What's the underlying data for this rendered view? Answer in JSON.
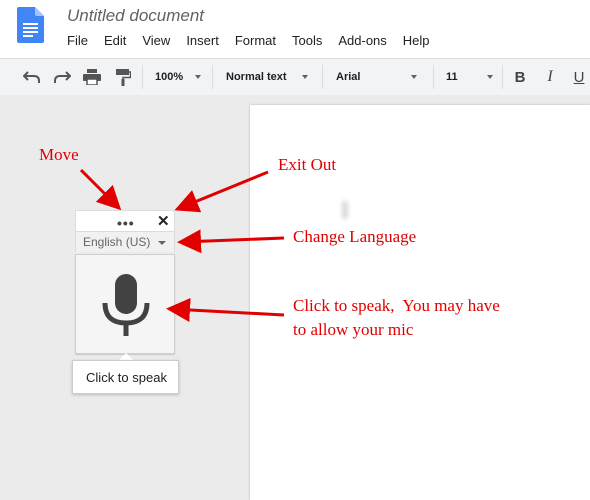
{
  "document": {
    "title": "Untitled document"
  },
  "menu": [
    "File",
    "Edit",
    "View",
    "Insert",
    "Format",
    "Tools",
    "Add-ons",
    "Help"
  ],
  "toolbar": {
    "zoom": "100%",
    "style": "Normal text",
    "font": "Arial",
    "size": "11",
    "bold": "B",
    "italic": "I",
    "underline": "U"
  },
  "voice_typing": {
    "language": "English (US)",
    "tooltip": "Click to speak"
  },
  "annotations": {
    "move": "Move",
    "exit": "Exit Out",
    "language": "Change Language",
    "speak_line1": "Click to speak,  You may have",
    "speak_line2": "to allow your mic"
  },
  "colors": {
    "annotation": "#e00000",
    "docs_blue": "#4285f4"
  }
}
